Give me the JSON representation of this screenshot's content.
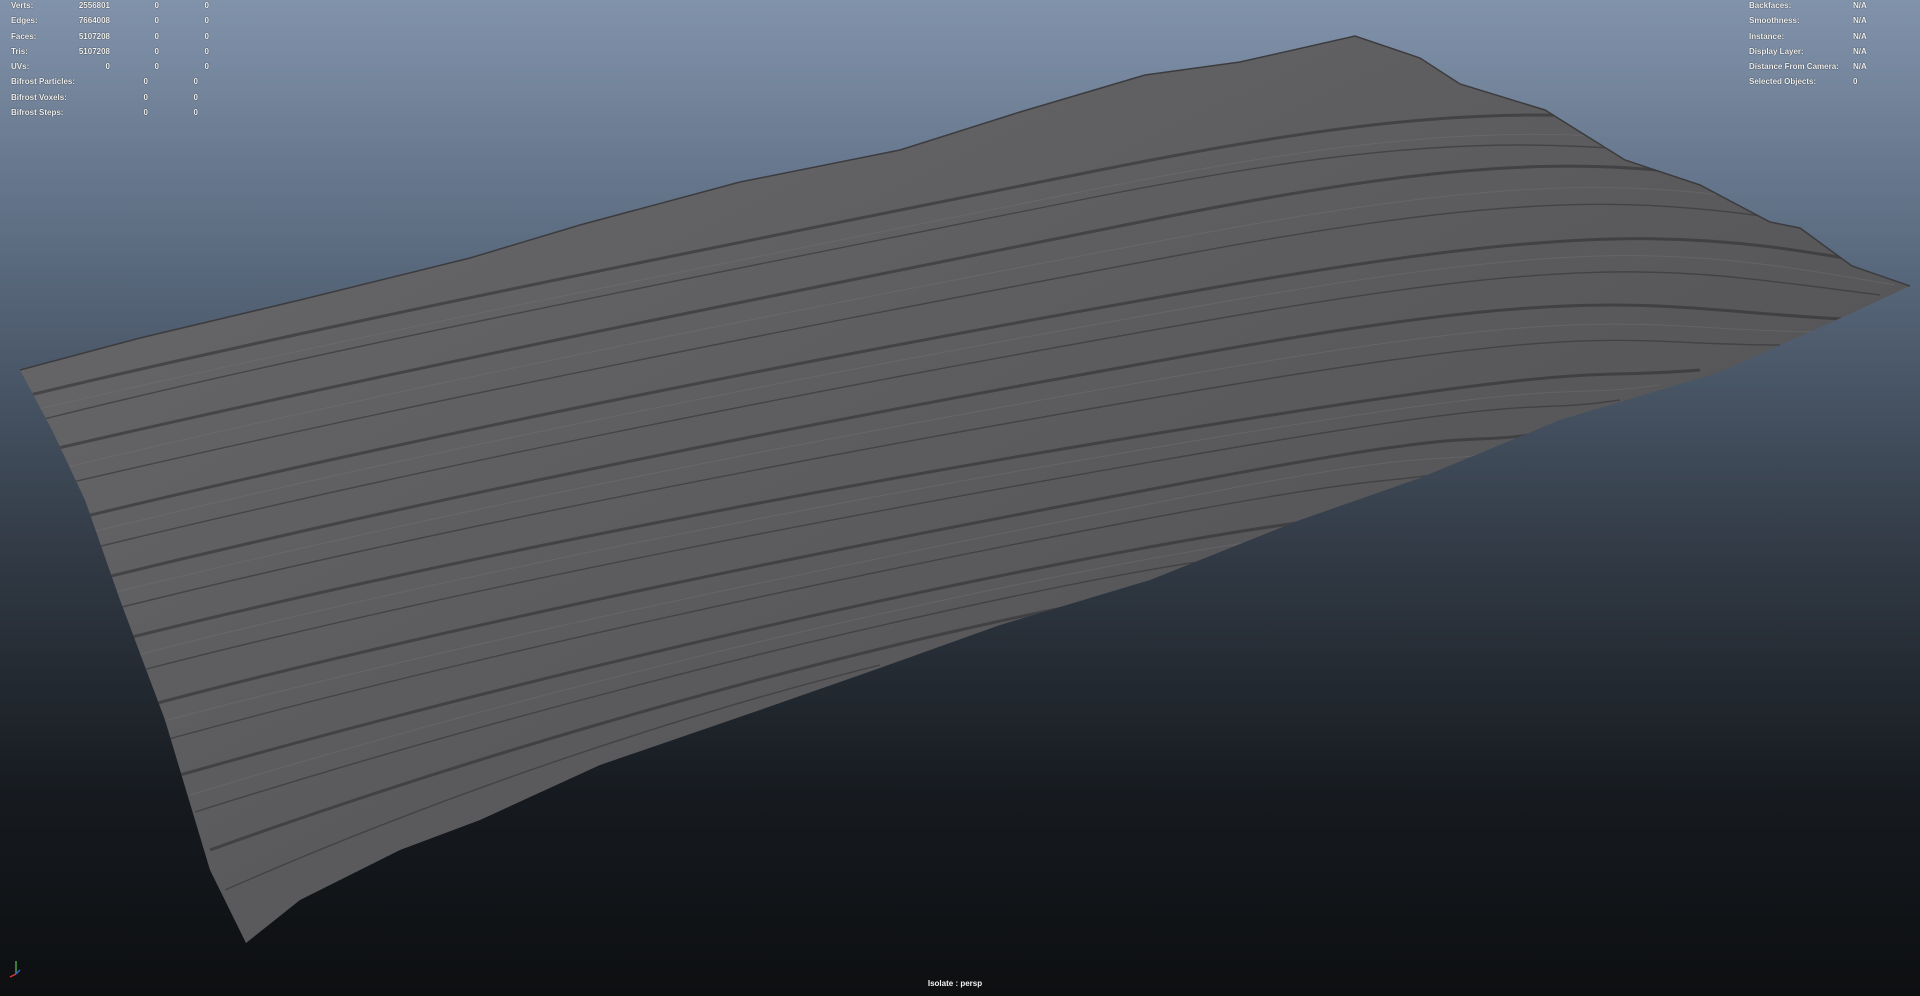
{
  "viewport": {
    "name": "persp",
    "colors": {
      "background_top": "#8193ab",
      "background_bottom": "#0d0f11",
      "mesh": "#5a5a5c",
      "hud_text": "#f2f2f2"
    }
  },
  "hud_left": {
    "rows": [
      {
        "label": "Verts:",
        "v1": "2556801",
        "v2": "0",
        "v3": "0"
      },
      {
        "label": "Edges:",
        "v1": "7664008",
        "v2": "0",
        "v3": "0"
      },
      {
        "label": "Faces:",
        "v1": "5107208",
        "v2": "0",
        "v3": "0"
      },
      {
        "label": "Tris:",
        "v1": "5107208",
        "v2": "0",
        "v3": "0"
      },
      {
        "label": "UVs:",
        "v1": "0",
        "v2": "0",
        "v3": "0"
      }
    ],
    "bifrost_rows": [
      {
        "label": "Bifrost Particles:",
        "v1": "0",
        "v2": "0"
      },
      {
        "label": "Bifrost Voxels:",
        "v1": "0",
        "v2": "0"
      },
      {
        "label": "Bifrost Steps:",
        "v1": "0",
        "v2": "0"
      }
    ]
  },
  "hud_right": {
    "rows": [
      {
        "label": "Backfaces:",
        "value": "N/A"
      },
      {
        "label": "Smoothness:",
        "value": "N/A"
      },
      {
        "label": "Instance:",
        "value": "N/A"
      },
      {
        "label": "Display Layer:",
        "value": "N/A"
      },
      {
        "label": "Distance From Camera:",
        "value": "N/A"
      },
      {
        "label": "Selected Objects:",
        "value": "0"
      }
    ]
  },
  "footer": {
    "isolate_label": "Isolate : persp"
  },
  "icons": {
    "axis_gizmo": "axis-gizmo-icon"
  }
}
